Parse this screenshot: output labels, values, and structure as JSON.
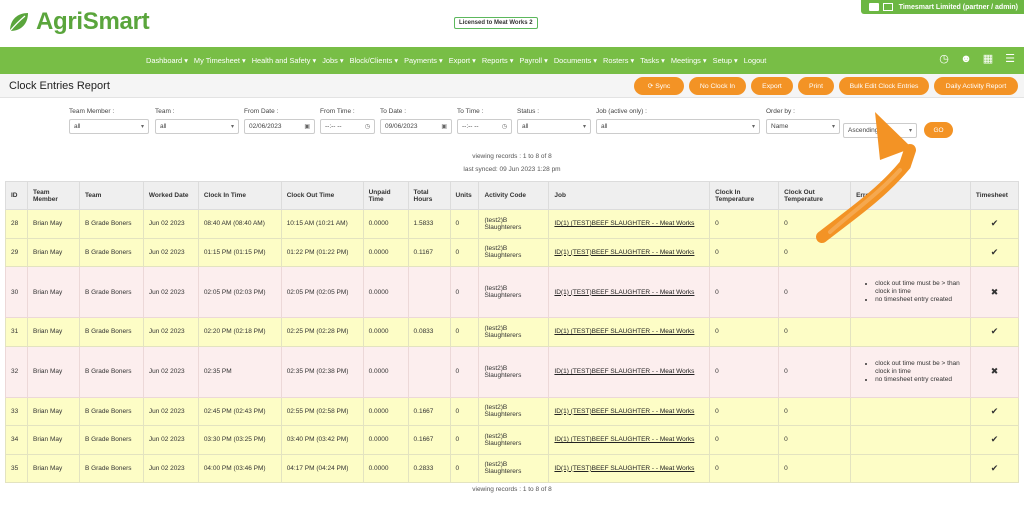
{
  "brand": {
    "name": "AgriSmart",
    "license": "Licensed to Meat Works 2",
    "company": "Timesmart Limited (partner / admin)"
  },
  "nav": {
    "items": [
      "Dashboard ▾",
      "My Timesheet ▾",
      "Health and Safety ▾",
      "Jobs ▾",
      "Block/Clients ▾",
      "Payments ▾",
      "Export ▾",
      "Reports ▾",
      "Payroll ▾",
      "Documents ▾",
      "Rosters ▾",
      "Tasks ▾",
      "Meetings ▾",
      "Setup ▾",
      "Logout"
    ],
    "icons": [
      "clock-icon",
      "users-icon",
      "qr-icon",
      "menu-icon"
    ]
  },
  "page": {
    "title": "Clock Entries Report",
    "buttons": {
      "sync": "⟳  Sync",
      "no_clock_in": "No Clock In",
      "export": "Export",
      "print": "Print",
      "bulk_edit": "Bulk Edit Clock Entries",
      "daily_activity": "Daily Activity Report"
    }
  },
  "filters": {
    "team_member": {
      "label": "Team Member :",
      "value": "all"
    },
    "team": {
      "label": "Team :",
      "value": "all"
    },
    "from_date": {
      "label": "From Date :",
      "value": "02/06/2023"
    },
    "from_time": {
      "label": "From Time :",
      "value": "--:-- --"
    },
    "to_date": {
      "label": "To Date :",
      "value": "09/06/2023"
    },
    "to_time": {
      "label": "To Time :",
      "value": "--:-- --"
    },
    "status": {
      "label": "Status :",
      "value": "all"
    },
    "job": {
      "label": "Job (active only) :",
      "value": "all"
    },
    "order_by": {
      "label": "Order by :",
      "value": "Name",
      "direction": "Ascending"
    },
    "go": "GO"
  },
  "meta": {
    "viewing": "viewing records : 1 to 8 of 8",
    "synced": "last synced: 09 Jun 2023 1:28 pm"
  },
  "table": {
    "headers": [
      "ID",
      "Team Member",
      "Team",
      "Worked Date",
      "Clock In Time",
      "Clock Out Time",
      "Unpaid Time",
      "Total Hours",
      "Units",
      "Activity Code",
      "Job",
      "Clock In Temperature",
      "Clock Out Temperature",
      "Errors",
      "Timesheet"
    ],
    "rows": [
      {
        "status": "ok",
        "id": "28",
        "member": "Brian May",
        "team": "B Grade Boners",
        "date": "Jun 02 2023",
        "in": "08:40 AM (08:40 AM)",
        "out": "10:15 AM (10:21 AM)",
        "unpaid": "0.0000",
        "total": "1.5833",
        "units": "0",
        "activity": "(test2)B Slaughterers",
        "job": "ID(1) (TEST)BEEF SLAUGHTER - - Meat Works",
        "tin": "0",
        "tout": "0",
        "errors": [],
        "timesheet": "✔"
      },
      {
        "status": "ok",
        "id": "29",
        "member": "Brian May",
        "team": "B Grade Boners",
        "date": "Jun 02 2023",
        "in": "01:15 PM (01:15 PM)",
        "out": "01:22 PM (01:22 PM)",
        "unpaid": "0.0000",
        "total": "0.1167",
        "units": "0",
        "activity": "(test2)B Slaughterers",
        "job": "ID(1) (TEST)BEEF SLAUGHTER - - Meat Works",
        "tin": "0",
        "tout": "0",
        "errors": [],
        "timesheet": "✔"
      },
      {
        "status": "err",
        "id": "30",
        "member": "Brian May",
        "team": "B Grade Boners",
        "date": "Jun 02 2023",
        "in": "02:05 PM (02:03 PM)",
        "out": "02:05 PM (02:05 PM)",
        "unpaid": "0.0000",
        "total": "",
        "units": "0",
        "activity": "(test2)B Slaughterers",
        "job": "ID(1) (TEST)BEEF SLAUGHTER - - Meat Works",
        "tin": "0",
        "tout": "0",
        "errors": [
          "clock out time must be > than clock in time",
          "no timesheet entry created"
        ],
        "timesheet": "✖"
      },
      {
        "status": "ok",
        "id": "31",
        "member": "Brian May",
        "team": "B Grade Boners",
        "date": "Jun 02 2023",
        "in": "02:20 PM (02:18 PM)",
        "out": "02:25 PM (02:28 PM)",
        "unpaid": "0.0000",
        "total": "0.0833",
        "units": "0",
        "activity": "(test2)B Slaughterers",
        "job": "ID(1) (TEST)BEEF SLAUGHTER - - Meat Works",
        "tin": "0",
        "tout": "0",
        "errors": [],
        "timesheet": "✔"
      },
      {
        "status": "err",
        "id": "32",
        "member": "Brian May",
        "team": "B Grade Boners",
        "date": "Jun 02 2023",
        "in": "02:35 PM",
        "out": "02:35 PM (02:38 PM)",
        "unpaid": "0.0000",
        "total": "",
        "units": "0",
        "activity": "(test2)B Slaughterers",
        "job": "ID(1) (TEST)BEEF SLAUGHTER - - Meat Works",
        "tin": "0",
        "tout": "0",
        "errors": [
          "clock out time must be > than clock in time",
          "no timesheet entry created"
        ],
        "timesheet": "✖"
      },
      {
        "status": "ok",
        "id": "33",
        "member": "Brian May",
        "team": "B Grade Boners",
        "date": "Jun 02 2023",
        "in": "02:45 PM (02:43 PM)",
        "out": "02:55 PM (02:58 PM)",
        "unpaid": "0.0000",
        "total": "0.1667",
        "units": "0",
        "activity": "(test2)B Slaughterers",
        "job": "ID(1) (TEST)BEEF SLAUGHTER - - Meat Works",
        "tin": "0",
        "tout": "0",
        "errors": [],
        "timesheet": "✔"
      },
      {
        "status": "ok",
        "id": "34",
        "member": "Brian May",
        "team": "B Grade Boners",
        "date": "Jun 02 2023",
        "in": "03:30 PM (03:25 PM)",
        "out": "03:40 PM (03:42 PM)",
        "unpaid": "0.0000",
        "total": "0.1667",
        "units": "0",
        "activity": "(test2)B Slaughterers",
        "job": "ID(1) (TEST)BEEF SLAUGHTER - - Meat Works",
        "tin": "0",
        "tout": "0",
        "errors": [],
        "timesheet": "✔"
      },
      {
        "status": "ok",
        "id": "35",
        "member": "Brian May",
        "team": "B Grade Boners",
        "date": "Jun 02 2023",
        "in": "04:00 PM (03:46 PM)",
        "out": "04:17 PM (04:24 PM)",
        "unpaid": "0.0000",
        "total": "0.2833",
        "units": "0",
        "activity": "(test2)B Slaughterers",
        "job": "ID(1) (TEST)BEEF SLAUGHTER - - Meat Works",
        "tin": "0",
        "tout": "0",
        "errors": [],
        "timesheet": "✔"
      }
    ]
  },
  "colors": {
    "green": "#78be46",
    "orange": "#f39325",
    "ok_row": "#fdfdc6",
    "err_row": "#fceeee"
  }
}
